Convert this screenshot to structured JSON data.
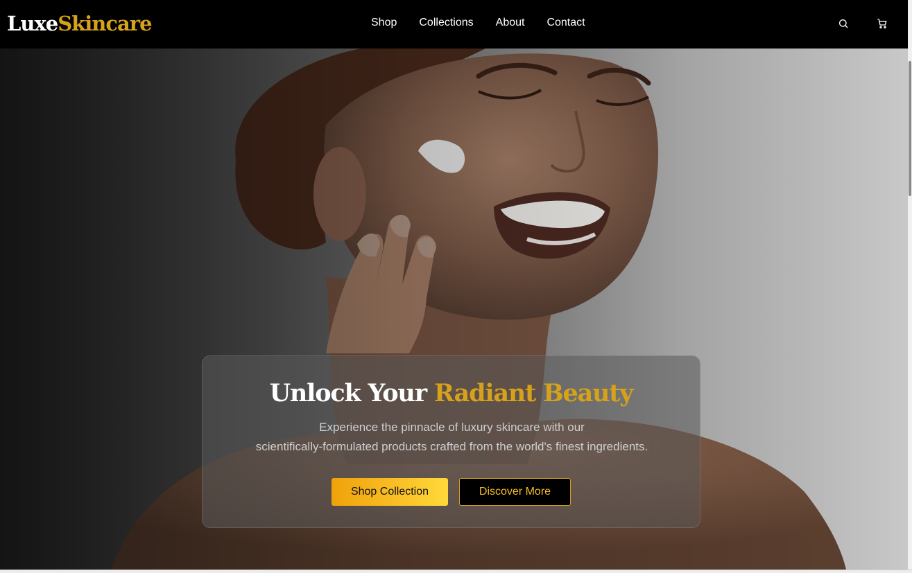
{
  "brand": {
    "part1": "Luxe",
    "part2": "Skincare"
  },
  "nav": {
    "links": [
      {
        "label": "Shop"
      },
      {
        "label": "Collections"
      },
      {
        "label": "About"
      },
      {
        "label": "Contact"
      }
    ],
    "icons": [
      "search-icon",
      "cart-icon"
    ]
  },
  "hero": {
    "title_part1": "Unlock Your",
    "title_part2": "Radiant Beauty",
    "subtitle_line1": "Experience the pinnacle of luxury skincare with our",
    "subtitle_line2": "scientifically-formulated products crafted from the world's finest ingredients.",
    "primary_button": "Shop Collection",
    "secondary_button": "Discover More"
  },
  "colors": {
    "accent_gold": "#d6a21a",
    "nav_background": "#000000",
    "button_gradient_start": "#f0a10a",
    "button_gradient_end": "#ffd83a"
  }
}
